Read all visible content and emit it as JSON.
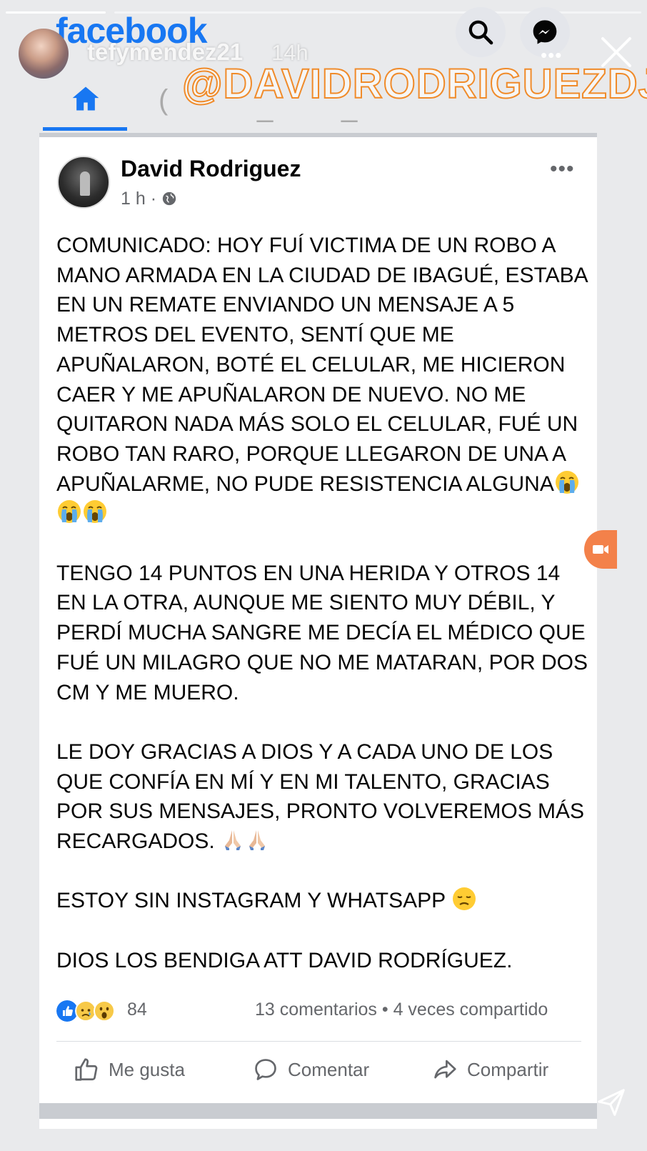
{
  "story": {
    "username": "tefymendez21",
    "time": "14h",
    "mention": "@DAVIDRODRIGUEZDJ"
  },
  "facebook": {
    "logo": "facebook"
  },
  "post": {
    "author": "David Rodriguez",
    "meta": "1 h ·",
    "paragraphs": {
      "p1": "COMUNICADO: HOY FUÍ VICTIMA DE UN ROBO A MANO ARMADA EN LA CIUDAD DE IBAGUÉ, ESTABA EN UN REMATE ENVIANDO UN MENSAJE A 5 METROS DEL EVENTO, SENTÍ QUE ME APUÑALARON, BOTÉ EL CELULAR, ME HICIERON CAER Y ME APUÑALARON DE NUEVO. NO ME QUITARON NADA MÁS SOLO EL CELULAR, FUÉ UN ROBO TAN RARO, PORQUE LLEGARON DE UNA A APUÑALARME, NO PUDE RESISTENCIA ALGUNA",
      "p2": "TENGO 14 PUNTOS EN UNA HERIDA Y OTROS 14 EN LA OTRA, AUNQUE ME SIENTO MUY DÉBIL, Y PERDÍ MUCHA SANGRE ME DECÍA EL MÉDICO QUE FUÉ UN MILAGRO QUE NO ME MATARAN, POR DOS CM Y ME MUERO.",
      "p3": "LE DOY GRACIAS A DIOS Y A CADA UNO DE LOS QUE CONFÍA EN MÍ Y EN MI TALENTO, GRACIAS POR SUS MENSAJES, PRONTO VOLVEREMOS MÁS RECARGADOS.",
      "p4": "ESTOY SIN INSTAGRAM Y WHATSAPP",
      "p5": "DIOS LOS BENDIGA ATT DAVID RODRÍGUEZ."
    },
    "reaction_count": "84",
    "comments_share": "13 comentarios • 4 veces compartido",
    "actions": {
      "like": "Me gusta",
      "comment": "Comentar",
      "share": "Compartir"
    }
  },
  "colors": {
    "facebook_blue": "#1877f2",
    "mention_outline": "#f08b2a",
    "secondary_text": "#65676b"
  },
  "icons": [
    "search-icon",
    "messenger-icon",
    "close-icon",
    "home-icon",
    "globe-icon",
    "more-icon",
    "like-reaction-icon",
    "sad-reaction-icon",
    "wow-reaction-icon",
    "thumbs-up-icon",
    "comment-icon",
    "share-icon",
    "video-call-icon",
    "send-icon",
    "crying-emoji-icon",
    "praying-hands-emoji-icon",
    "disappointed-emoji-icon"
  ]
}
